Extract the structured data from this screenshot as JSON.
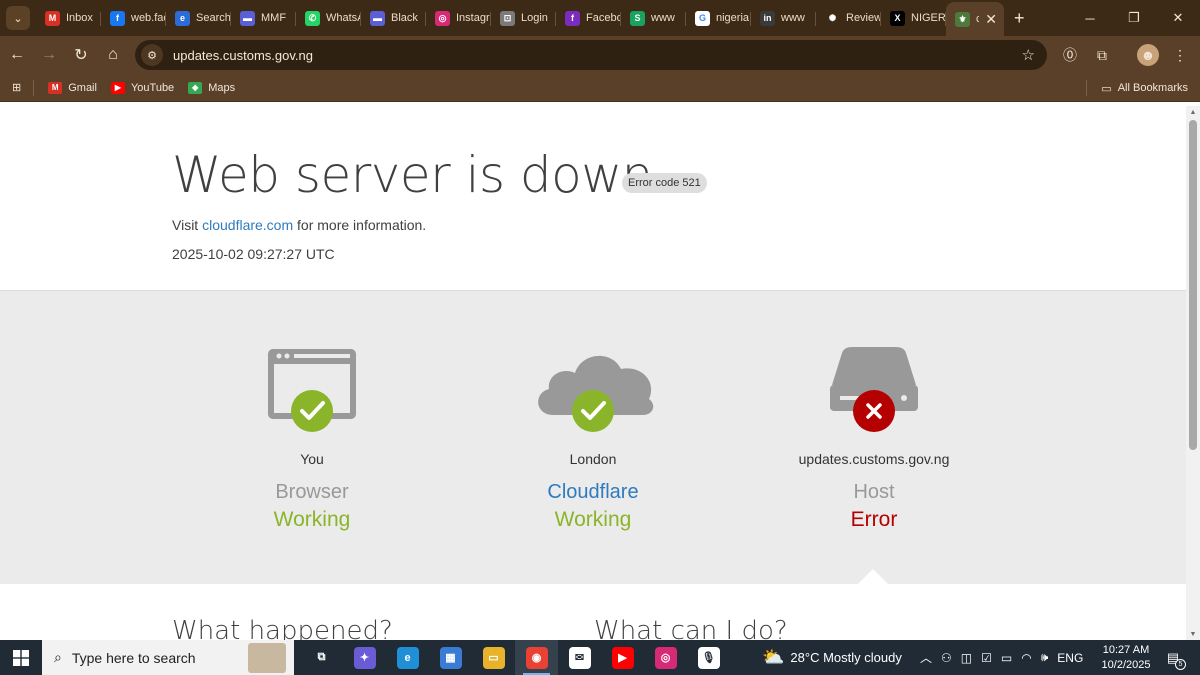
{
  "browser": {
    "tabs": [
      {
        "title": "Inbox",
        "icon": "gmail-icon",
        "color": "#d93025",
        "glyph": "M"
      },
      {
        "title": "web.facebook",
        "icon": "facebook-icon",
        "color": "#1877f2",
        "glyph": "f"
      },
      {
        "title": "Search",
        "icon": "copilot-icon",
        "color": "#2b6cd6",
        "glyph": "e"
      },
      {
        "title": "MMF",
        "icon": "app-icon",
        "color": "#5b5fd6",
        "glyph": "▬"
      },
      {
        "title": "WhatsApp",
        "icon": "whatsapp-icon",
        "color": "#25d366",
        "glyph": "✆"
      },
      {
        "title": "Black",
        "icon": "app-icon",
        "color": "#5b5fd6",
        "glyph": "▬"
      },
      {
        "title": "Instagram",
        "icon": "instagram-icon",
        "color": "#d62976",
        "glyph": "◎"
      },
      {
        "title": "Login",
        "icon": "lock-icon",
        "color": "#7a7a7a",
        "glyph": "⊡"
      },
      {
        "title": "Facebook",
        "icon": "facebook-icon",
        "color": "#7b2cbf",
        "glyph": "f"
      },
      {
        "title": "www",
        "icon": "s-icon",
        "color": "#1aa260",
        "glyph": "S"
      },
      {
        "title": "nigeria",
        "icon": "google-icon",
        "color": "#ffffff",
        "glyph": "G"
      },
      {
        "title": "www",
        "icon": "linkedin-icon",
        "color": "#3a3a3a",
        "glyph": "in"
      },
      {
        "title": "Review",
        "icon": "chatgpt-icon",
        "color": "#3c2a16",
        "glyph": "✺"
      },
      {
        "title": "NIGERIA",
        "icon": "x-icon",
        "color": "#000000",
        "glyph": "X"
      }
    ],
    "active_tab": {
      "title": "c",
      "icon": "coat-of-arms-icon",
      "color": "#4d7a3a"
    },
    "url": "updates.customs.gov.ng",
    "bookmarks": [
      {
        "label": "Gmail",
        "icon": "gmail-icon",
        "color": "#d93025",
        "glyph": "M"
      },
      {
        "label": "YouTube",
        "icon": "youtube-icon",
        "color": "#ff0000",
        "glyph": "▶"
      },
      {
        "label": "Maps",
        "icon": "maps-icon",
        "color": "#34a853",
        "glyph": "◆"
      }
    ],
    "all_bookmarks": "All Bookmarks"
  },
  "page": {
    "title": "Web server is down",
    "error_code": "Error code 521",
    "visit_prefix": "Visit",
    "visit_link": "cloudflare.com",
    "visit_suffix": "for more information.",
    "timestamp": "2025-10-02 09:27:27 UTC",
    "nodes": [
      {
        "place": "You",
        "role": "Browser",
        "state": "Working",
        "status": "ok"
      },
      {
        "place": "London",
        "role": "Cloudflare",
        "state": "Working",
        "status": "ok"
      },
      {
        "place": "updates.customs.gov.ng",
        "role": "Host",
        "state": "Error",
        "status": "error"
      }
    ],
    "what_happened": "What happened?",
    "what_can_i_do": "What can I do?",
    "colors": {
      "ok": "#8ab52a",
      "error": "#b40000",
      "link": "#2f7bbf",
      "icon_gray": "#999999"
    }
  },
  "taskbar": {
    "search_placeholder": "Type here to search",
    "apps": [
      {
        "name": "task-view",
        "color": "#202b36",
        "glyph": "⧉"
      },
      {
        "name": "copilot",
        "color": "#6b5bd6",
        "glyph": "✦"
      },
      {
        "name": "edge",
        "color": "#1f8fd6",
        "glyph": "e"
      },
      {
        "name": "store",
        "color": "#3a7bd5",
        "glyph": "▦"
      },
      {
        "name": "file-explorer",
        "color": "#e8b32a",
        "glyph": "▭"
      },
      {
        "name": "chrome",
        "color": "#e94235",
        "glyph": "◉",
        "active": true
      },
      {
        "name": "mail",
        "color": "#ffffff",
        "glyph": "✉"
      },
      {
        "name": "youtube",
        "color": "#ff0000",
        "glyph": "▶"
      },
      {
        "name": "instagram",
        "color": "#d62976",
        "glyph": "◎"
      },
      {
        "name": "voice",
        "color": "#ffffff",
        "glyph": "🎙"
      }
    ],
    "weather": "28°C  Mostly cloudy",
    "language": "ENG",
    "time": "10:27 AM",
    "date": "10/2/2025",
    "notifications": "5"
  }
}
